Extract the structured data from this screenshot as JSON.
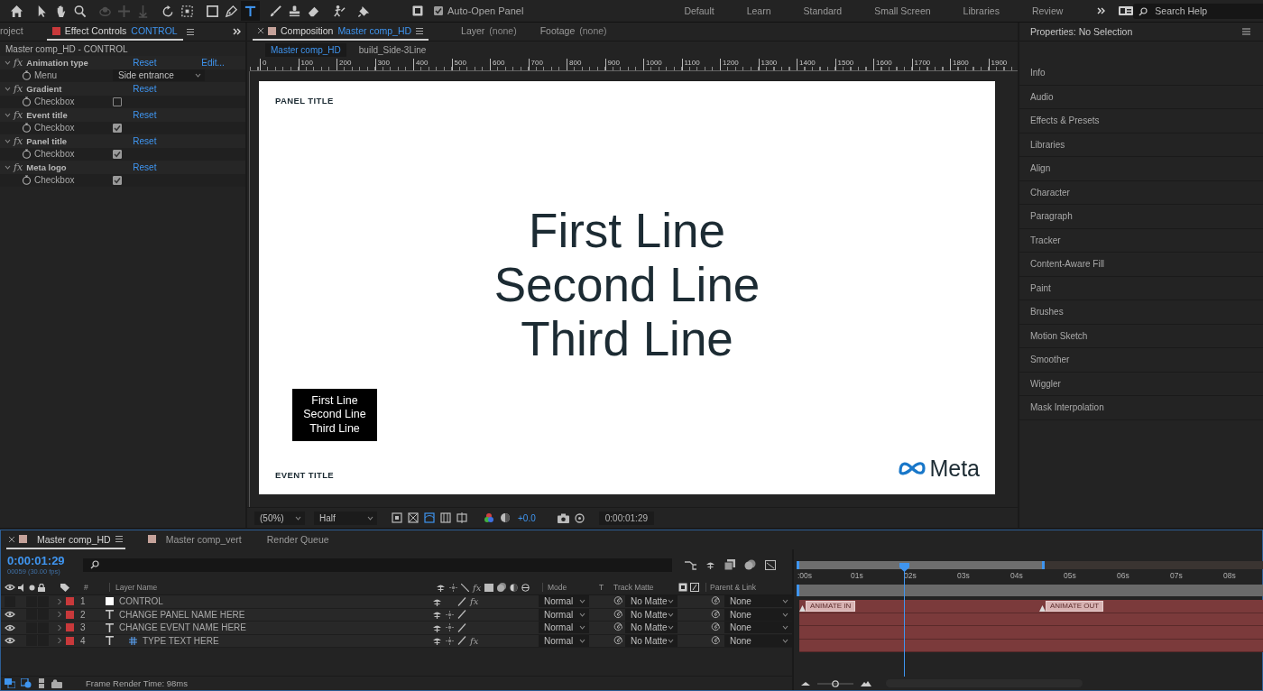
{
  "toolbar": {
    "tools": [
      {
        "kind": "home",
        "selected": false,
        "disabled": false
      },
      {
        "kind": "selection",
        "selected": false,
        "disabled": false
      },
      {
        "kind": "hand",
        "selected": false,
        "disabled": false
      },
      {
        "kind": "zoom",
        "selected": false,
        "disabled": false
      },
      {
        "kind": "orbit",
        "selected": false,
        "disabled": true
      },
      {
        "kind": "pan",
        "selected": false,
        "disabled": true
      },
      {
        "kind": "dolly",
        "selected": false,
        "disabled": true
      },
      {
        "kind": "rotation",
        "selected": false,
        "disabled": false
      },
      {
        "kind": "region",
        "selected": false,
        "disabled": false
      },
      {
        "kind": "rectangle",
        "selected": false,
        "disabled": false
      },
      {
        "kind": "pen",
        "selected": false,
        "disabled": false
      },
      {
        "kind": "type",
        "selected": true,
        "disabled": false
      },
      {
        "kind": "brush",
        "selected": false,
        "disabled": false
      },
      {
        "kind": "stamp",
        "selected": false,
        "disabled": false
      },
      {
        "kind": "eraser",
        "selected": false,
        "disabled": false
      },
      {
        "kind": "roto",
        "selected": false,
        "disabled": false
      },
      {
        "kind": "pin",
        "selected": false,
        "disabled": false
      }
    ],
    "auto_open_panel": {
      "label": "Auto-Open Panel",
      "checked": true
    },
    "workspaces": [
      "Default",
      "Learn",
      "Standard",
      "Small Screen",
      "Libraries",
      "Review"
    ],
    "search": {
      "placeholder": "Search Help"
    }
  },
  "effect_controls": {
    "tabs": [
      {
        "label": "roject",
        "selected": false
      },
      {
        "label": "Effect Controls",
        "target": "CONTROL",
        "selected": true
      }
    ],
    "subtitle": "Master comp_HD - CONTROL",
    "effects": [
      {
        "badge": "fx",
        "name": "Animation type",
        "reset": "Reset",
        "edit": "Edit...",
        "param": {
          "kind": "menu",
          "label": "Menu",
          "value": "Side entrance"
        }
      },
      {
        "badge": "fx",
        "name": "Gradient",
        "reset": "Reset",
        "param": {
          "kind": "checkbox",
          "label": "Checkbox",
          "checked": false
        }
      },
      {
        "badge": "fx",
        "name": "Event title",
        "reset": "Reset",
        "param": {
          "kind": "checkbox",
          "label": "Checkbox",
          "checked": true
        }
      },
      {
        "badge": "fx",
        "name": "Panel title",
        "reset": "Reset",
        "param": {
          "kind": "checkbox",
          "label": "Checkbox",
          "checked": true
        }
      },
      {
        "badge": "fx",
        "name": "Meta logo",
        "reset": "Reset",
        "param": {
          "kind": "checkbox",
          "label": "Checkbox",
          "checked": true
        }
      }
    ]
  },
  "viewer": {
    "tabs": [
      {
        "label": "Composition",
        "target": "Master comp_HD",
        "selected": true
      },
      {
        "label": "Layer",
        "target": "(none)",
        "selected": false
      },
      {
        "label": "Footage",
        "target": "(none)",
        "selected": false
      }
    ],
    "breadcrumbs": [
      {
        "label": "Master comp_HD",
        "selected": true
      },
      {
        "label": "build_Side-3Line",
        "selected": false
      }
    ],
    "ruler": [
      "0",
      "100",
      "200",
      "300",
      "400",
      "500",
      "600",
      "700",
      "800",
      "900",
      "1000",
      "1100",
      "1200",
      "1300",
      "1400",
      "1500",
      "1600",
      "1700",
      "1800",
      "1900"
    ],
    "canvas": {
      "panel_title": "PANEL TITLE",
      "lines": [
        "First Line",
        "Second Line",
        "Third Line"
      ],
      "thumbnail_lines": [
        "First Line",
        "Second Line",
        "Third Line"
      ],
      "event_title": "EVENT TITLE",
      "logo": "Meta"
    },
    "bar": {
      "zoom": "(50%)",
      "resolution": "Half",
      "exposure": "+0.0",
      "timecode": "0:00:01:29"
    }
  },
  "properties": {
    "title": "Properties: No Selection",
    "items": [
      "Info",
      "Audio",
      "Effects & Presets",
      "Libraries",
      "Align",
      "Character",
      "Paragraph",
      "Tracker",
      "Content-Aware Fill",
      "Paint",
      "Brushes",
      "Motion Sketch",
      "Smoother",
      "Wiggler",
      "Mask Interpolation"
    ]
  },
  "timeline": {
    "tabs": [
      {
        "label": "Master comp_HD",
        "kind": "comp",
        "selected": true
      },
      {
        "label": "Master comp_vert",
        "kind": "comp",
        "selected": false
      },
      {
        "label": "Render Queue",
        "kind": "queue",
        "selected": false
      }
    ],
    "timecode": "0:00:01:29",
    "frames": "00059 (30.00 fps)",
    "columns": {
      "index": "#",
      "name": "Layer Name",
      "fx": "fx",
      "mode": "Mode",
      "t": "T",
      "matte": "Track Matte",
      "parent": "Parent & Link"
    },
    "layers": [
      {
        "index": "1",
        "kind": "solid",
        "name": "CONTROL",
        "visible": false,
        "solo": false,
        "locked": false,
        "color": "#c8393b",
        "fx": {
          "label": "fx",
          "on": true
        },
        "mode": "Normal",
        "matte": "No Matte",
        "parent": "None"
      },
      {
        "index": "2",
        "kind": "text",
        "name": "CHANGE PANEL NAME HERE",
        "visible": true,
        "solo": false,
        "locked": false,
        "color": "#c8393b",
        "mode": "Normal",
        "matte": "No Matte",
        "parent": "None"
      },
      {
        "index": "3",
        "kind": "text",
        "name": "CHANGE EVENT NAME HERE",
        "visible": true,
        "solo": false,
        "locked": false,
        "color": "#c8393b",
        "mode": "Normal",
        "matte": "No Matte",
        "parent": "None"
      },
      {
        "index": "4",
        "kind": "text_grid",
        "name": "TYPE TEXT HERE",
        "visible": true,
        "solo": false,
        "locked": false,
        "color": "#c8393b",
        "fx": {
          "label": "fx",
          "on": true
        },
        "mode": "Normal",
        "matte": "No Matte",
        "parent": "None"
      }
    ],
    "time_ruler": [
      ":00s",
      "01s",
      "02s",
      "03s",
      "04s",
      "05s",
      "06s",
      "07s",
      "08s"
    ],
    "markers": [
      {
        "label": "ANIMATE IN"
      },
      {
        "label": "ANIMATE OUT"
      }
    ],
    "status": "Frame Render Time:  98ms"
  }
}
